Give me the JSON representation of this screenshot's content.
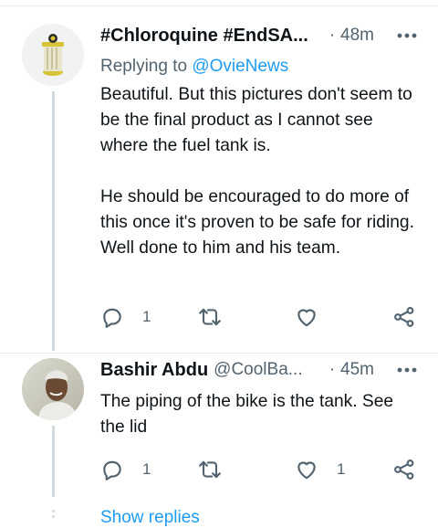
{
  "tweets": [
    {
      "name": "#Chloroquine #EndSA...",
      "handle": "",
      "separator": "·",
      "time": "48m",
      "replying_prefix": "Replying to",
      "replying_to": "@OvieNews",
      "paragraphs": [
        "Beautiful. But this pictures don't seem to be the final product as I cannot see where the fuel tank is.",
        "He should be encouraged to do more of this once it's proven to be safe for riding. Well done to him and his team."
      ],
      "reply_count": "1",
      "retweet_count": "",
      "like_count": ""
    },
    {
      "name": "Bashir Abdu",
      "handle": "@CoolBa...",
      "separator": "·",
      "time": "45m",
      "paragraphs": [
        "The piping of the bike is the tank. See the lid"
      ],
      "reply_count": "1",
      "retweet_count": "",
      "like_count": "1"
    }
  ],
  "show_replies": "Show replies",
  "colors": {
    "accent": "#1d9bf0",
    "secondary_text": "#536471",
    "thread_line": "#cfd9de"
  },
  "icons": [
    "reply-icon",
    "retweet-icon",
    "like-icon",
    "share-icon",
    "more-icon"
  ]
}
